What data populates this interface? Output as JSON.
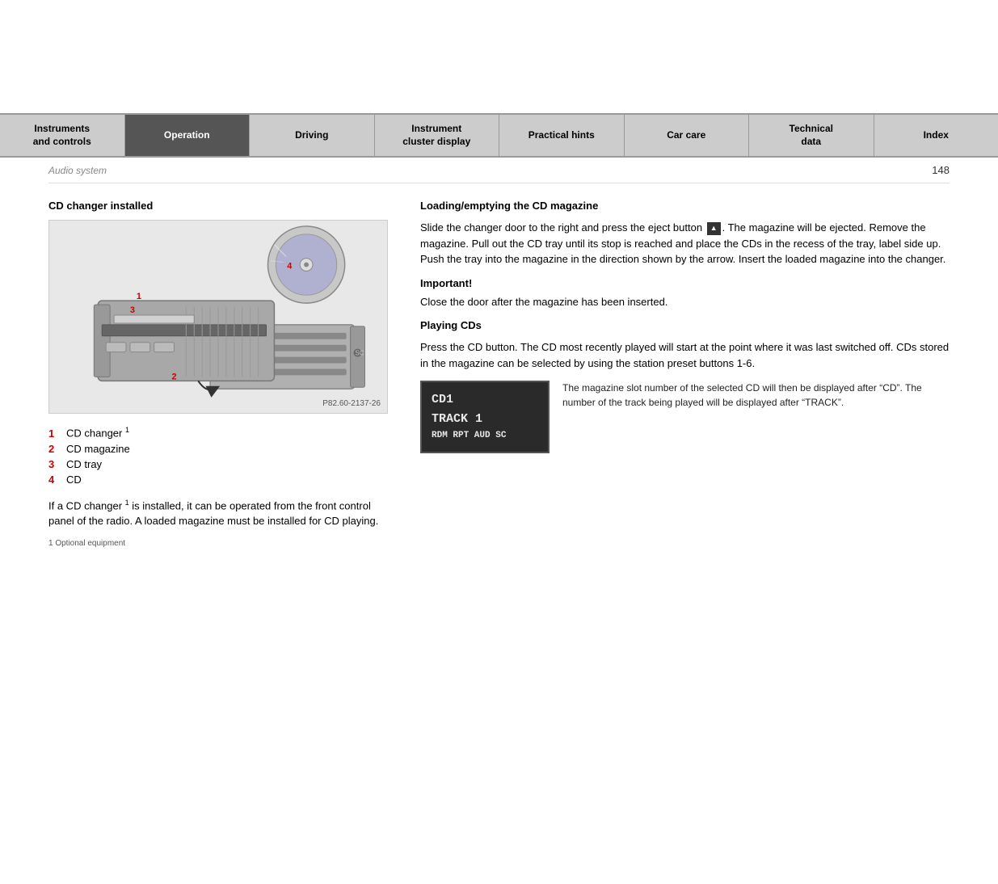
{
  "nav": {
    "items": [
      {
        "id": "instruments",
        "label": "Instruments\nand controls",
        "active": false
      },
      {
        "id": "operation",
        "label": "Operation",
        "active": true
      },
      {
        "id": "driving",
        "label": "Driving",
        "active": false
      },
      {
        "id": "instrument-cluster",
        "label": "Instrument\ncluster display",
        "active": false
      },
      {
        "id": "practical-hints",
        "label": "Practical hints",
        "active": false
      },
      {
        "id": "car-care",
        "label": "Car care",
        "active": false
      },
      {
        "id": "technical-data",
        "label": "Technical\ndata",
        "active": false
      },
      {
        "id": "index",
        "label": "Index",
        "active": false
      }
    ]
  },
  "page": {
    "section": "Audio system",
    "number": "148"
  },
  "left": {
    "heading": "CD changer installed",
    "image_caption": "P82.60-2137-26",
    "list": [
      {
        "num": "1",
        "text": "CD changer"
      },
      {
        "num": "2",
        "text": "CD magazine"
      },
      {
        "num": "3",
        "text": "CD tray"
      },
      {
        "num": "4",
        "text": "CD"
      }
    ],
    "body_text": "If a CD changer¹ is installed, it can be operated from the front control panel of the radio. A loaded magazine must be installed for CD playing.",
    "footnote": "1   Optional equipment"
  },
  "right": {
    "loading_heading": "Loading/emptying the CD magazine",
    "loading_text": "Slide the changer door to the right and press the eject button ▲. The magazine will be ejected. Remove the magazine. Pull out the CD tray until its stop is reached and place the CDs in the recess of the tray, label side up. Push the tray into the magazine in the direction shown by the arrow. Insert the loaded magazine into the changer.",
    "important_label": "Important!",
    "important_text": "Close the door after the magazine has been inserted.",
    "playing_heading": "Playing CDs",
    "playing_text": "Press the CD button. The CD most recently played will start at the point where it was last switched off. CDs stored in the magazine can be selected by using the station preset buttons 1-6.",
    "lcd": {
      "line1": "CD1",
      "line2": "TRACK 1",
      "line3": "RDM RPT AUD SC"
    },
    "lcd_desc": "The magazine slot number of the selected CD will then be displayed after “CD”. The number of the track being played will be displayed after “TRACK”."
  }
}
